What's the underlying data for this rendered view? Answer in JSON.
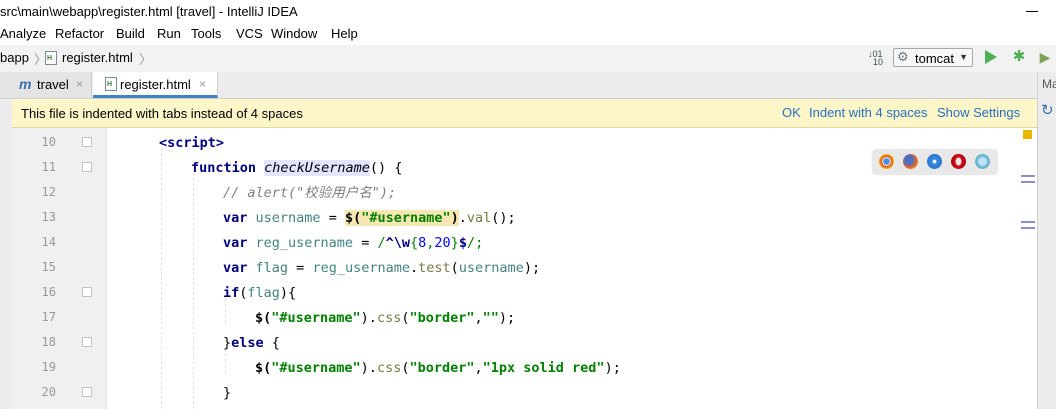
{
  "window": {
    "title": "src\\main\\webapp\\register.html [travel] - IntelliJ IDEA"
  },
  "menu": {
    "items": [
      "Analyze",
      "Refactor",
      "Build",
      "Run",
      "Tools",
      "VCS",
      "Window",
      "Help"
    ]
  },
  "navbar": {
    "crumbs": [
      "bapp",
      "register.html"
    ],
    "run_config": "tomcat"
  },
  "tabs": [
    {
      "label": "travel",
      "icon": "m-module-icon",
      "active": false
    },
    {
      "label": "register.html",
      "icon": "html-file-icon",
      "active": true
    }
  ],
  "right_strip": {
    "label": "Ma"
  },
  "banner": {
    "message": "This file is indented with tabs instead of 4 spaces",
    "ok": "OK",
    "indent": "Indent with 4 spaces",
    "settings": "Show Settings",
    "bg_color": "#fcf6c8",
    "link_color": "#2a6ebf"
  },
  "editor": {
    "line_numbers": [
      "10",
      "11",
      "12",
      "13",
      "14",
      "15",
      "16",
      "17",
      "18",
      "19",
      "20"
    ],
    "browser_icons": [
      "chrome-icon",
      "firefox-icon",
      "safari-icon",
      "opera-icon",
      "ie-icon"
    ]
  },
  "code": {
    "l10": {
      "tag": "<script>"
    },
    "l11": {
      "kw": "function",
      "name": "checkUsername",
      "rest": "() {"
    },
    "l12": {
      "comment": "// alert(\"校验用户名\");"
    },
    "l13": {
      "kw": "var",
      "var": "username",
      "eq": " = ",
      "dollar": "$(",
      "str": "\"#username\"",
      "close": ")",
      "dot": ".",
      "method": "val",
      "end": "();"
    },
    "l14": {
      "kw": "var",
      "var": "reg_username",
      "eq": " = ",
      "r1": "/",
      "r2": "^\\w",
      "r3": "{",
      "n1": "8",
      "r4": ",",
      "n2": "20",
      "r5": "}",
      "r6": "$",
      "r7": "/;"
    },
    "l15": {
      "kw": "var",
      "var": "flag",
      "eq": " = ",
      "obj": "reg_username",
      "dot": ".",
      "method": "test",
      "open": "(",
      "arg": "username",
      "end": ");"
    },
    "l16": {
      "kw": "if",
      "open": "(",
      "arg": "flag",
      "end": "){"
    },
    "l17": {
      "dollar": "$(",
      "str": "\"#username\"",
      "close": ").",
      "method": "css",
      "open": "(",
      "s1": "\"border\"",
      "comma": ",",
      "s2": "\"\"",
      "end": ");"
    },
    "l18": {
      "brace": "}",
      "kw": "else",
      "rest": " {"
    },
    "l19": {
      "dollar": "$(",
      "str": "\"#username\"",
      "close": ").",
      "method": "css",
      "open": "(",
      "s1": "\"border\"",
      "comma": ",",
      "s2": "\"1px solid red\"",
      "end": ");"
    },
    "l20": {
      "brace": "}"
    }
  }
}
